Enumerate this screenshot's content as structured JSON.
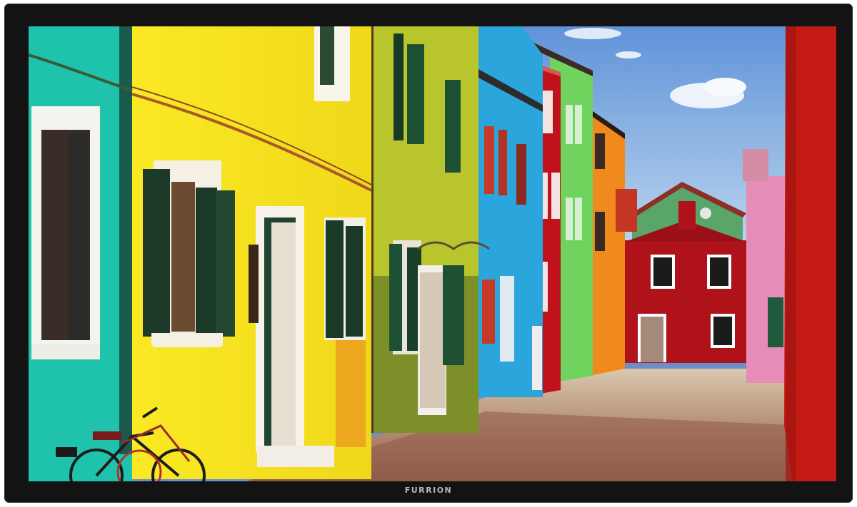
{
  "device": {
    "brand_logo": "FURRION",
    "screen_content": "colorful-street-photo"
  },
  "colors": {
    "bezel": "#131313",
    "teal_house": "#1fc3ab",
    "yellow_house": "#f6e61a",
    "olive_house": "#b9c52c",
    "blue_house": "#2aa6dc",
    "red_house": "#b8141c",
    "green_house": "#6fd35e",
    "orange_house": "#f08a1c",
    "pink_house": "#e890b8",
    "sky": "#6a9ad8"
  }
}
